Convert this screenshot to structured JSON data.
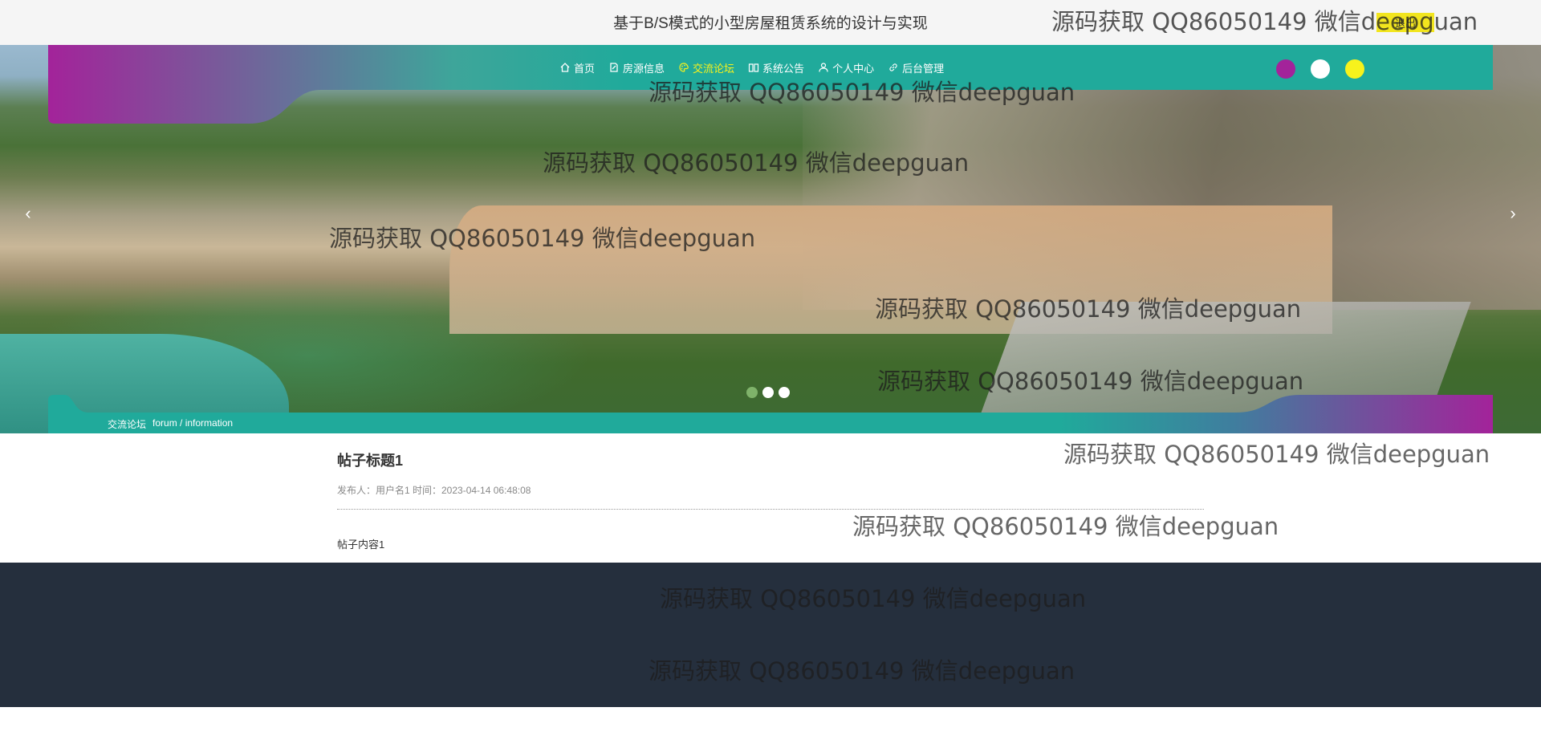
{
  "header": {
    "site_title": "基于B/S模式的小型房屋租赁系统的设计与实现",
    "logout_label": "退出"
  },
  "nav": {
    "items": [
      {
        "label": "首页",
        "icon": "home-icon",
        "active": false
      },
      {
        "label": "房源信息",
        "icon": "document-icon",
        "active": false
      },
      {
        "label": "交流论坛",
        "icon": "palette-icon",
        "active": true
      },
      {
        "label": "系统公告",
        "icon": "book-icon",
        "active": false
      },
      {
        "label": "个人中心",
        "icon": "user-icon",
        "active": false
      },
      {
        "label": "后台管理",
        "icon": "link-icon",
        "active": false
      }
    ],
    "active_color": "#f7f21c"
  },
  "theme_colors": [
    "#a3239a",
    "#ffffff",
    "#f7f21c"
  ],
  "breadcrumb": {
    "current": "交流论坛",
    "path": "forum / information"
  },
  "post": {
    "title": "帖子标题1",
    "meta": "发布人：用户名1 时间：2023-04-14 06:48:08",
    "content": "帖子内容1"
  },
  "carousel": {
    "prev_icon": "chevron-left-icon",
    "next_icon": "chevron-right-icon",
    "slides": 3,
    "active_slide": 1
  },
  "watermark": {
    "text": "源码获取 QQ86050149 微信deepguan"
  },
  "colors": {
    "teal": "#20aa9b",
    "purple": "#a3239a",
    "footer": "#252f3d",
    "logout_bg": "#f2e51e"
  }
}
